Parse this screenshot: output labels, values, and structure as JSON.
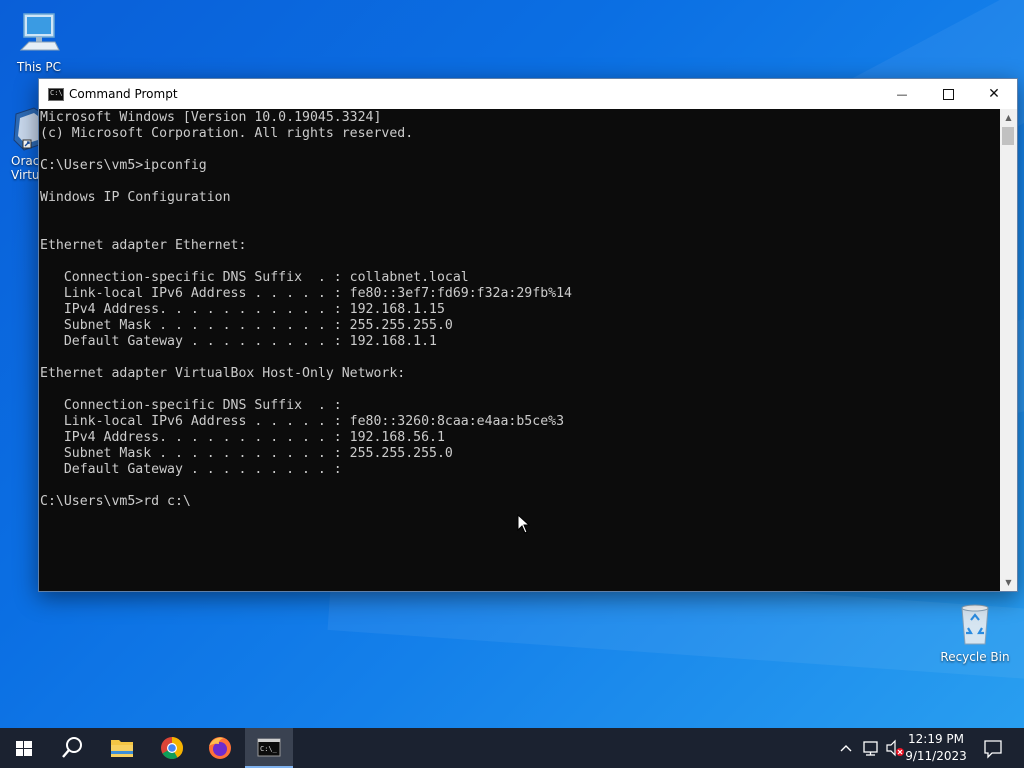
{
  "desktop": {
    "icons": {
      "this_pc": "This PC",
      "oracle_vbox_line1": "Oracl",
      "oracle_vbox_line2": "Virtua",
      "recycle_bin": "Recycle Bin"
    }
  },
  "window": {
    "title": "Command Prompt",
    "buttons": {
      "minimize": "—",
      "close": "✕"
    },
    "console_lines": [
      "Microsoft Windows [Version 10.0.19045.3324]",
      "(c) Microsoft Corporation. All rights reserved.",
      "",
      "C:\\Users\\vm5>ipconfig",
      "",
      "Windows IP Configuration",
      "",
      "",
      "Ethernet adapter Ethernet:",
      "",
      "   Connection-specific DNS Suffix  . : collabnet.local",
      "   Link-local IPv6 Address . . . . . : fe80::3ef7:fd69:f32a:29fb%14",
      "   IPv4 Address. . . . . . . . . . . : 192.168.1.15",
      "   Subnet Mask . . . . . . . . . . . : 255.255.255.0",
      "   Default Gateway . . . . . . . . . : 192.168.1.1",
      "",
      "Ethernet adapter VirtualBox Host-Only Network:",
      "",
      "   Connection-specific DNS Suffix  . :",
      "   Link-local IPv6 Address . . . . . : fe80::3260:8caa:e4aa:b5ce%3",
      "   IPv4 Address. . . . . . . . . . . : 192.168.56.1",
      "   Subnet Mask . . . . . . . . . . . : 255.255.255.0",
      "   Default Gateway . . . . . . . . . :",
      "",
      "C:\\Users\\vm5>rd c:\\"
    ]
  },
  "taskbar": {
    "clock": {
      "time": "12:19 PM",
      "date": "9/11/2023"
    }
  },
  "colors": {
    "console_bg": "#0c0c0c",
    "console_fg": "#cccccc",
    "taskbar_bg": "#1b2230",
    "accent": "#0b6fe3"
  }
}
